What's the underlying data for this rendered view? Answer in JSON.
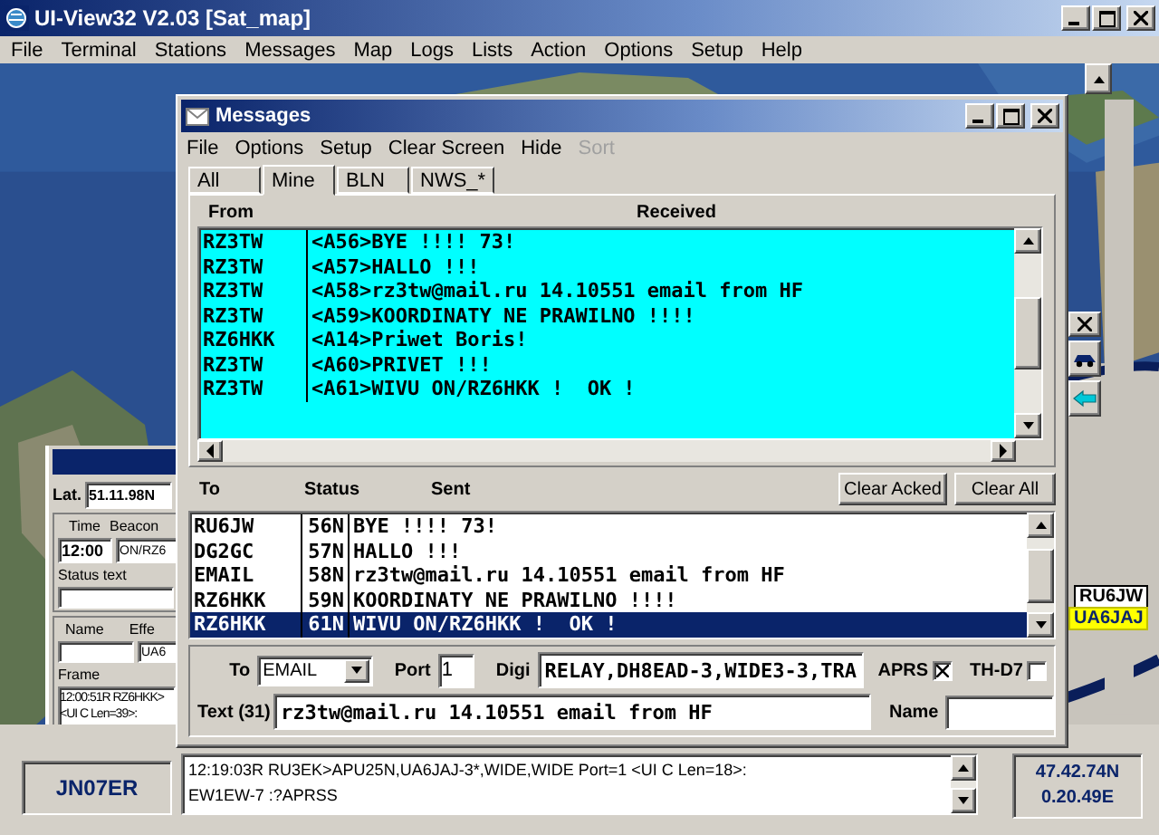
{
  "app": {
    "title": "UI-View32 V2.03 [Sat_map]",
    "menu": [
      "File",
      "Terminal",
      "Stations",
      "Messages",
      "Map",
      "Logs",
      "Lists",
      "Action",
      "Options",
      "Setup",
      "Help"
    ]
  },
  "map_labels": [
    {
      "text": "RU6JW",
      "kind": "plain"
    },
    {
      "text": "UA6JAJ",
      "kind": "highlight"
    }
  ],
  "station_panel": {
    "lat_label": "Lat.",
    "lat": "51.11.98N",
    "time_label": "Time",
    "beacon_label": "Beacon",
    "time": "12:00",
    "beacon": "ON/RZ6",
    "status_label": "Status text",
    "name_label": "Name",
    "effect_label": "Effe",
    "effect": "UA6",
    "frame_label": "Frame",
    "frame": [
      "12:00:51R RZ6HKK>",
      "<UI C Len=39>:"
    ]
  },
  "messages": {
    "title": "Messages",
    "menu": [
      {
        "label": "File",
        "disabled": false
      },
      {
        "label": "Options",
        "disabled": false
      },
      {
        "label": "Setup",
        "disabled": false
      },
      {
        "label": "Clear Screen",
        "disabled": false
      },
      {
        "label": "Hide",
        "disabled": false
      },
      {
        "label": "Sort",
        "disabled": true
      }
    ],
    "tabs": [
      {
        "label": "All",
        "selected": false
      },
      {
        "label": "Mine",
        "selected": true
      },
      {
        "label": "BLN",
        "selected": false
      },
      {
        "label": "NWS_*",
        "selected": false
      }
    ],
    "received": {
      "columns": [
        "From",
        "Received"
      ],
      "rows": [
        {
          "from": "RZ3TW",
          "text": "<A56>BYE !!!! 73!"
        },
        {
          "from": "RZ3TW",
          "text": "<A57>HALLO !!!"
        },
        {
          "from": "RZ3TW",
          "text": "<A58>rz3tw@mail.ru 14.10551 email from HF"
        },
        {
          "from": "RZ3TW",
          "text": "<A59>KOORDINATY NE PRAWILNO !!!!"
        },
        {
          "from": "RZ6HKK",
          "text": "<A14>Priwet Boris!"
        },
        {
          "from": "RZ3TW",
          "text": "<A60>PRIVET !!!"
        },
        {
          "from": "RZ3TW",
          "text": "<A61>WIVU ON/RZ6HKK !  OK !"
        }
      ]
    },
    "sent": {
      "columns": [
        "To",
        "Status",
        "Sent"
      ],
      "buttons": [
        "Clear Acked",
        "Clear All"
      ],
      "rows": [
        {
          "to": "RU6JW",
          "status": "56N",
          "text": "BYE !!!! 73!",
          "selected": false
        },
        {
          "to": "DG2GC",
          "status": "57N",
          "text": "HALLO !!!",
          "selected": false
        },
        {
          "to": "EMAIL",
          "status": "58N",
          "text": "rz3tw@mail.ru 14.10551 email from HF",
          "selected": false
        },
        {
          "to": "RZ6HKK",
          "status": "59N",
          "text": "KOORDINATY NE PRAWILNO !!!!",
          "selected": false
        },
        {
          "to": "RZ6HKK",
          "status": "61N",
          "text": "WIVU ON/RZ6HKK !  OK !",
          "selected": true
        }
      ]
    },
    "form": {
      "to_label": "To",
      "to": "EMAIL",
      "port_label": "Port",
      "port": "1",
      "digi_label": "Digi",
      "digi": "RELAY,DH8EAD-3,WIDE3-3,TRA",
      "checks": [
        {
          "label": "APRS",
          "checked": true
        },
        {
          "label": "TH-D7",
          "checked": false
        }
      ],
      "text_label": "Text (31)",
      "text": "rz3tw@mail.ru 14.10551 email from HF",
      "name_label": "Name"
    }
  },
  "status_bar": {
    "locator": "JN07ER",
    "log": [
      "12:19:03R RU3EK>APU25N,UA6JAJ-3*,WIDE,WIDE Port=1 <UI C Len=18>:",
      "EW1EW-7 :?APRSS"
    ],
    "coords": [
      "47.42.74N",
      "0.20.49E"
    ]
  }
}
